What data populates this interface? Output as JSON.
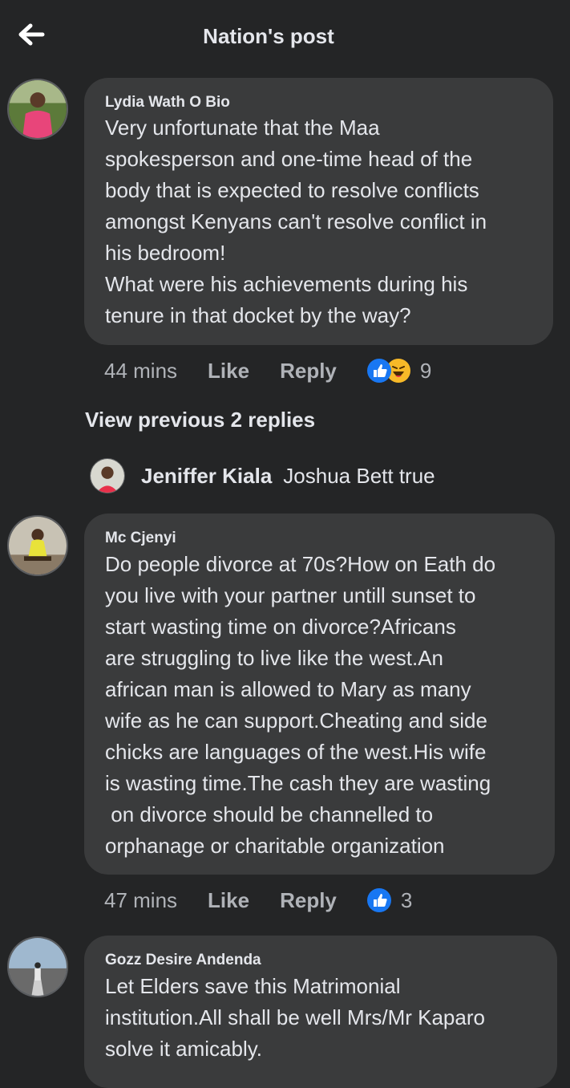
{
  "header": {
    "title": "Nation's post"
  },
  "comments": [
    {
      "author": "Lydia Wath O Bio",
      "text": "Very unfortunate that the Maa\nspokesperson and one-time head of the\nbody that is expected to resolve conflicts\namongst Kenyans can't resolve conflict in\nhis bedroom!\nWhat were his achievements during his\ntenure in that docket by the way?",
      "time": "44 mins",
      "like_label": "Like",
      "reply_label": "Reply",
      "reaction_count": "9",
      "reactions": [
        "like-icon",
        "haha-icon"
      ]
    },
    {
      "author": "Mc Cjenyi",
      "text": "Do people divorce at 70s?How on Eath do\nyou live with your partner untill sunset to\nstart wasting time on divorce?Africans\nare struggling to live like the west.An\nafrican man is allowed to Mary as many\nwife as he can support.Cheating and side\nchicks are languages of the west.His wife\nis wasting time.The cash they are wasting\n on divorce should be channelled to\norphanage or charitable organization",
      "time": "47 mins",
      "like_label": "Like",
      "reply_label": "Reply",
      "reaction_count": "3",
      "reactions": [
        "like-icon"
      ]
    },
    {
      "author": "Gozz Desire Andenda",
      "text": "Let Elders save this Matrimonial\ninstitution.All shall be well Mrs/Mr Kaparo\nsolve it amicably."
    }
  ],
  "replies_thread": {
    "view_previous": "View previous 2 replies",
    "reply_author": "Jeniffer Kiala",
    "reply_text": "Joshua Bett true"
  },
  "colors": {
    "background": "#242526",
    "bubble": "#3a3b3c",
    "like_blue": "#1877f2",
    "haha_yellow": "#f7b928",
    "secondary_text": "#b0b3b8"
  }
}
